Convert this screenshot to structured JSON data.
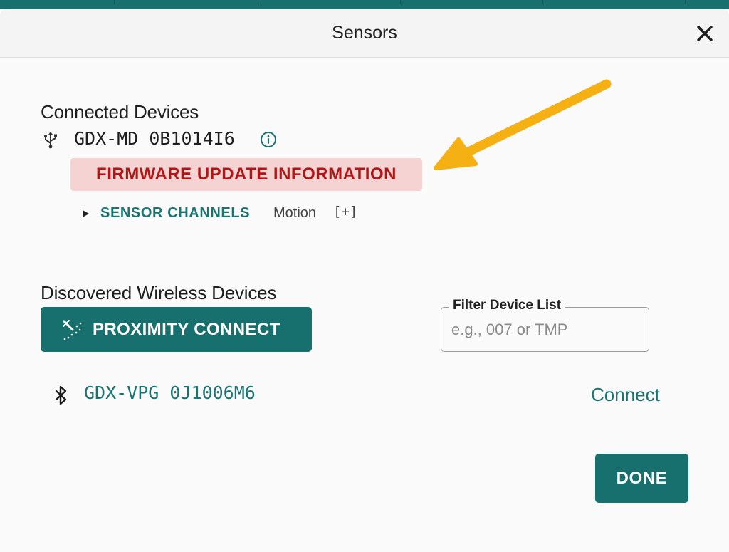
{
  "dialog": {
    "title": "Sensors",
    "close_icon": "close-icon"
  },
  "connected": {
    "heading": "Connected Devices",
    "device": {
      "icon": "usb-icon",
      "name": "GDX-MD 0B1014I6",
      "info_icon": "info-icon"
    },
    "firmware_banner": "FIRMWARE UPDATE INFORMATION",
    "sensor_channels": {
      "label": "SENSOR CHANNELS",
      "value": "Motion",
      "expand": "[+]"
    }
  },
  "wireless": {
    "heading": "Discovered Wireless Devices",
    "proximity_button": "PROXIMITY CONNECT",
    "filter": {
      "label": "Filter Device List",
      "placeholder": "e.g., 007 or TMP",
      "value": ""
    },
    "devices": [
      {
        "icon": "bluetooth-icon",
        "name": "GDX-VPG 0J1006M6",
        "action": "Connect"
      }
    ]
  },
  "footer": {
    "done_label": "DONE"
  },
  "colors": {
    "accent": "#17706e",
    "banner_bg": "#f6d3d3",
    "banner_text": "#b01616",
    "annotation_arrow": "#f5b013"
  }
}
